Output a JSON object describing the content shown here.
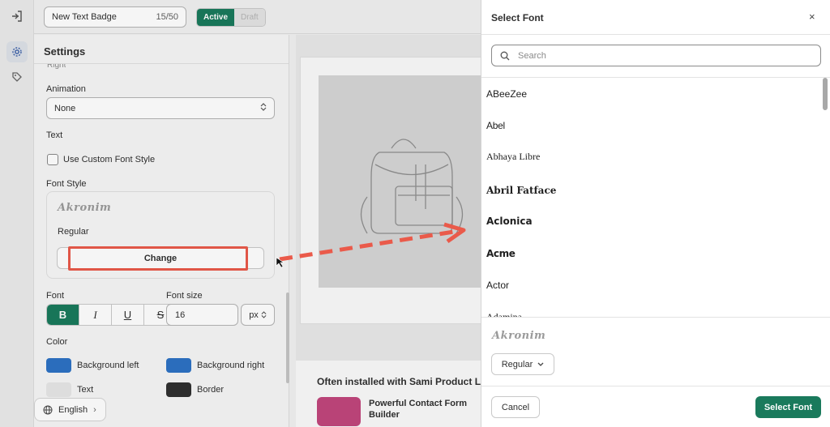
{
  "editor": {
    "badge_name": "New  Text Badge",
    "char_count": "15/50",
    "status_active": "Active",
    "status_draft": "Draft"
  },
  "settings": {
    "title": "Settings",
    "cut_label": "Right",
    "animation_label": "Animation",
    "animation_value": "None",
    "text_label": "Text",
    "custom_font_label": "Use Custom Font Style",
    "font_style_label": "Font Style",
    "font_preview": "Akronim",
    "font_weight": "Regular",
    "change_button": "Change",
    "font_label": "Font",
    "font_size_label": "Font size",
    "font_size_value": "16",
    "font_size_unit": "px",
    "format_buttons": {
      "bold": "B",
      "italic": "I",
      "underline": "U",
      "strike": "S"
    },
    "color_label": "Color",
    "colors": {
      "bg_left_label": "Background left",
      "bg_left": "#2d72c4",
      "bg_right_label": "Background right",
      "bg_right": "#2d72c4",
      "text_label": "Text",
      "text": "#e6e6e6",
      "border_label": "Border",
      "border": "#303030"
    },
    "language": "English"
  },
  "preview": {
    "often_title": "Often installed with Sami Product La",
    "app_name": "Powerful Contact Form Builder"
  },
  "modal": {
    "title": "Select Font",
    "close_icon": "×",
    "search_placeholder": "Search",
    "fonts": [
      "ABeeZee",
      "Abel",
      "Abhaya Libre",
      "Abril Fatface",
      "Aclonica",
      "Acme",
      "Actor",
      "Adamina"
    ],
    "selected_preview": "Akronim",
    "variant": "Regular",
    "cancel": "Cancel",
    "confirm": "Select Font"
  },
  "colors": {
    "accent": "#1a7a5c",
    "annotation": "#ea5a4a"
  }
}
